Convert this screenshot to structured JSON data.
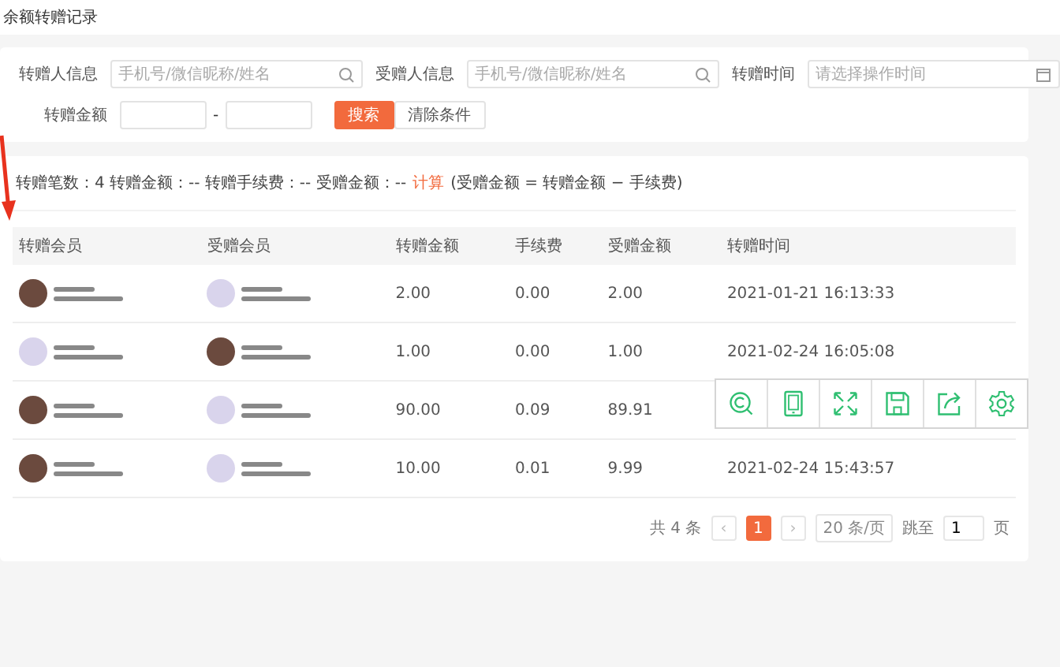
{
  "page_title": "余额转赠记录",
  "filters": {
    "fields": [
      {
        "label": "转赠人信息",
        "placeholder": "手机号/微信昵称/姓名",
        "kind": "search"
      },
      {
        "label": "受赠人信息",
        "placeholder": "手机号/微信昵称/姓名",
        "kind": "search"
      },
      {
        "label": "转赠时间",
        "placeholder": "请选择操作时间",
        "kind": "date"
      }
    ],
    "amount_label": "转赠金额",
    "range_separator": "-",
    "buttons": [
      {
        "label": "搜索",
        "kind": "primary"
      },
      {
        "label": "清除条件",
        "kind": "default"
      }
    ]
  },
  "summary": {
    "text": "转赠笔数：4  转赠金额：--  转赠手续费：--  受赠金额：--",
    "link": "计算",
    "formula": "(受赠金额 = 转赠金额 − 手续费)"
  },
  "table": {
    "columns": [
      "转赠会员",
      "受赠会员",
      "转赠金额",
      "手续费",
      "受赠金额",
      "转赠时间"
    ],
    "rows": [
      {
        "sender_avatar": {
          "color": "#6b4a3e"
        },
        "receiver_avatar": {
          "color": "#d9d4ec"
        },
        "amount": "2.00",
        "fee": "0.00",
        "received": "2.00",
        "time": "2021-01-21 16:13:33"
      },
      {
        "sender_avatar": {
          "color": "#d9d4ec"
        },
        "receiver_avatar": {
          "color": "#6b4a3e"
        },
        "amount": "1.00",
        "fee": "0.00",
        "received": "1.00",
        "time": "2021-02-24 16:05:08"
      },
      {
        "sender_avatar": {
          "color": "#6b4a3e"
        },
        "receiver_avatar": {
          "color": "#d9d4ec"
        },
        "amount": "90.00",
        "fee": "0.09",
        "received": "89.91"
      },
      {
        "sender_avatar": {
          "color": "#6b4a3e"
        },
        "receiver_avatar": {
          "color": "#d9d4ec"
        },
        "amount": "10.00",
        "fee": "0.01",
        "received": "9.99",
        "time": "2021-02-24 15:43:57"
      }
    ]
  },
  "pagination": {
    "total": "共 4 条",
    "prev": "‹",
    "pages": [
      {
        "label": "1",
        "selected": true
      }
    ],
    "next": "›",
    "page_size": "20 条/页",
    "jump_label": "跳至",
    "jump_value": "1",
    "jump_suffix": "页"
  }
}
